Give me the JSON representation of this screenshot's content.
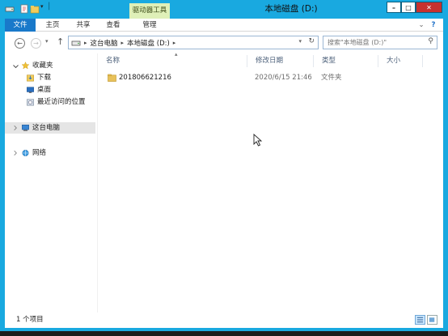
{
  "window": {
    "title": "本地磁盘 (D:)",
    "contextual_tab_group": "驱动器工具",
    "controls": {
      "minimize": "–",
      "maximize": "□",
      "close": "✕"
    }
  },
  "ribbon": {
    "tabs": [
      {
        "label": "文件"
      },
      {
        "label": "主页"
      },
      {
        "label": "共享"
      },
      {
        "label": "查看"
      },
      {
        "label": "管理"
      }
    ],
    "expand_glyph": "⌄",
    "help_glyph": "?"
  },
  "nav": {
    "back_glyph": "←",
    "forward_glyph": "→",
    "recent_glyph": "▾",
    "up_glyph": "↑",
    "breadcrumb": [
      {
        "label": "这台电脑"
      },
      {
        "label": "本地磁盘 (D:)"
      }
    ],
    "separator_glyph": "▸",
    "address_dropdown_glyph": "▾",
    "refresh_glyph": "↻",
    "search_placeholder": "搜索\"本地磁盘 (D:)\"",
    "search_glyph": "⚲"
  },
  "sidebar": {
    "items": [
      {
        "label": "收藏夹",
        "icon": "star-icon"
      },
      {
        "label": "下载",
        "icon": "download-folder-icon"
      },
      {
        "label": "桌面",
        "icon": "desktop-icon"
      },
      {
        "label": "最近访问的位置",
        "icon": "recent-places-icon"
      },
      {
        "label": "这台电脑",
        "icon": "computer-icon"
      },
      {
        "label": "网络",
        "icon": "network-icon"
      }
    ]
  },
  "columns": {
    "name": "名称",
    "date": "修改日期",
    "type": "类型",
    "size": "大小"
  },
  "files": [
    {
      "name": "201806621216",
      "date": "2020/6/15 21:46",
      "type": "文件夹",
      "size": ""
    }
  ],
  "status": {
    "item_count": "1 个项目"
  },
  "colors": {
    "titlebar": "#19a9e0",
    "file_tab": "#1979ca",
    "context_tab": "#dff0b8",
    "selected_nav": "#e5e5e5",
    "folder": "#e8c15a"
  }
}
